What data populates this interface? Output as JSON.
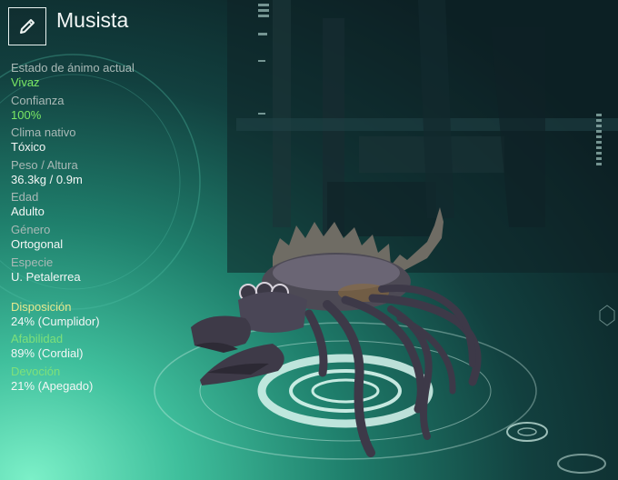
{
  "creature": {
    "name": "Musista"
  },
  "stats": [
    {
      "label": "Estado de ánimo actual",
      "value": "Vivaz"
    },
    {
      "label": "Confianza",
      "value": "100%"
    },
    {
      "label": "Clima nativo",
      "value": "Tóxico"
    },
    {
      "label": "Peso / Altura",
      "value": "36.3kg / 0.9m"
    },
    {
      "label": "Edad",
      "value": "Adulto"
    },
    {
      "label": "Género",
      "value": "Ortogonal"
    },
    {
      "label": "Especie",
      "value": "U. Petalerrea"
    }
  ],
  "traits": [
    {
      "label": "Disposición",
      "value": "24% (Cumplidor)"
    },
    {
      "label": "Afabilidad",
      "value": "89% (Cordial)"
    },
    {
      "label": "Devoción",
      "value": "21% (Apegado)"
    }
  ],
  "icons": {
    "rename": "pencil-icon"
  },
  "colors": {
    "highlight_value": "#7be864",
    "disposition_label": "#e6e88f",
    "trait_label": "#7ee07a"
  }
}
